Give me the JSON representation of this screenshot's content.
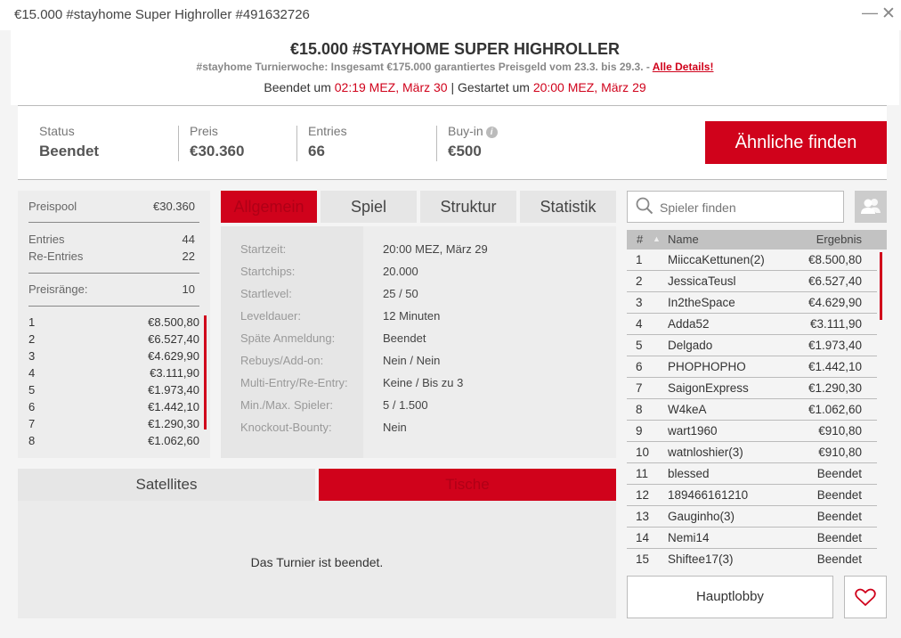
{
  "window": {
    "title": "€15.000 #stayhome Super Highroller #491632726",
    "minimize_glyph": "—",
    "close_glyph": "✕"
  },
  "header": {
    "title": "€15.000 #STAYHOME SUPER HIGHROLLER",
    "subtitle": "#stayhome Turnierwoche: Insgesamt €175.000 garantiertes Preisgeld vom 23.3. bis 29.3. - ",
    "details_link": "Alle Details!",
    "ended_label": "Beendet um ",
    "ended_time": "02:19 MEZ, März 30",
    "separator": " | ",
    "started_label": "Gestartet um ",
    "started_time": "20:00 MEZ, März 29"
  },
  "stats": {
    "status_label": "Status",
    "status_value": "Beendet",
    "prize_label": "Preis",
    "prize_value": "€30.360",
    "entries_label": "Entries",
    "entries_value": "66",
    "buyin_label": "Buy-in",
    "buyin_value": "€500",
    "info_glyph": "i",
    "similar_button": "Ähnliche finden"
  },
  "prize_panel": {
    "pool_label": "Preispool",
    "pool_value": "€30.360",
    "entries_label": "Entries",
    "entries_value": "44",
    "reentries_label": "Re-Entries",
    "reentries_value": "22",
    "ranks_label": "Preisränge:",
    "ranks_value": "10",
    "prizes": [
      {
        "rank": "1",
        "amount": "€8.500,80"
      },
      {
        "rank": "2",
        "amount": "€6.527,40"
      },
      {
        "rank": "3",
        "amount": "€4.629,90"
      },
      {
        "rank": "4",
        "amount": "€3.111,90"
      },
      {
        "rank": "5",
        "amount": "€1.973,40"
      },
      {
        "rank": "6",
        "amount": "€1.442,10"
      },
      {
        "rank": "7",
        "amount": "€1.290,30"
      },
      {
        "rank": "8",
        "amount": "€1.062,60"
      }
    ]
  },
  "tabs": [
    "Allgemein",
    "Spiel",
    "Struktur",
    "Statistik"
  ],
  "info": [
    {
      "key": "Startzeit:",
      "value": "20:00 MEZ, März 29"
    },
    {
      "key": "Startchips:",
      "value": "20.000"
    },
    {
      "key": "Startlevel:",
      "value": "25 / 50"
    },
    {
      "key": "Leveldauer:",
      "value": "12 Minuten"
    },
    {
      "key": "Späte Anmeldung:",
      "value": "Beendet"
    },
    {
      "key": "Rebuys/Add-on:",
      "value": "Nein / Nein"
    },
    {
      "key": "Multi-Entry/Re-Entry:",
      "value": "Keine / Bis zu 3"
    },
    {
      "key": "Min./Max. Spieler:",
      "value": "5 / 1.500"
    },
    {
      "key": "Knockout-Bounty:",
      "value": "Nein"
    }
  ],
  "bottom_tabs": {
    "satellites": "Satellites",
    "tables": "Tische",
    "message": "Das Turnier ist beendet."
  },
  "search": {
    "placeholder": "Spieler finden"
  },
  "players": {
    "headers": {
      "rank": "#",
      "sort_glyph": "▲",
      "name": "Name",
      "result": "Ergebnis"
    },
    "rows": [
      {
        "rank": "1",
        "name": "MiiccaKettunen(2)",
        "result": "€8.500,80"
      },
      {
        "rank": "2",
        "name": "JessicaTeusl",
        "result": "€6.527,40"
      },
      {
        "rank": "3",
        "name": "In2theSpace",
        "result": "€4.629,90"
      },
      {
        "rank": "4",
        "name": "Adda52",
        "result": "€3.111,90"
      },
      {
        "rank": "5",
        "name": "Delgado",
        "result": "€1.973,40"
      },
      {
        "rank": "6",
        "name": "PHOPHOPHO",
        "result": "€1.442,10"
      },
      {
        "rank": "7",
        "name": "SaigonExpress",
        "result": "€1.290,30"
      },
      {
        "rank": "8",
        "name": "W4keA",
        "result": "€1.062,60"
      },
      {
        "rank": "9",
        "name": "wart1960",
        "result": "€910,80"
      },
      {
        "rank": "10",
        "name": "watnloshier(3)",
        "result": "€910,80"
      },
      {
        "rank": "11",
        "name": "blessed",
        "result": "Beendet"
      },
      {
        "rank": "12",
        "name": "189466161210",
        "result": "Beendet"
      },
      {
        "rank": "13",
        "name": "Gauginho(3)",
        "result": "Beendet"
      },
      {
        "rank": "14",
        "name": "Nemi14",
        "result": "Beendet"
      },
      {
        "rank": "15",
        "name": "Shiftee17(3)",
        "result": "Beendet"
      }
    ]
  },
  "lobby_button": "Hauptlobby",
  "colors": {
    "accent": "#d0021b",
    "panel": "#ededed",
    "background": "#f4f4f4"
  },
  "icons": {
    "search": "search-icon",
    "friends": "friends-icon",
    "favorite": "heart-icon",
    "info": "info-icon"
  }
}
